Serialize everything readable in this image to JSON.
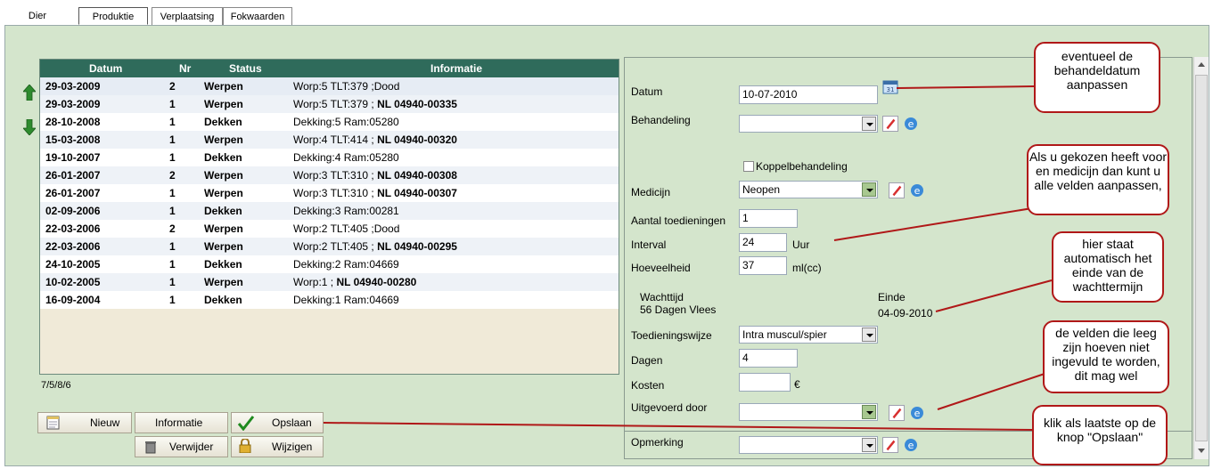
{
  "tabs": [
    "Dier",
    "Produktie",
    "Verplaatsing",
    "Fokwaarden"
  ],
  "table": {
    "headers": {
      "datum": "Datum",
      "nr": "Nr",
      "status": "Status",
      "informatie": "Informatie"
    },
    "rows": [
      {
        "datum": "29-03-2009",
        "nr": "2",
        "status": "Werpen",
        "info": "Worp:5 TLT:379 ;Dood",
        "info_bold": ""
      },
      {
        "datum": "29-03-2009",
        "nr": "1",
        "status": "Werpen",
        "info": "Worp:5 TLT:379 ; ",
        "info_bold": "NL 04940-00335"
      },
      {
        "datum": "28-10-2008",
        "nr": "1",
        "status": "Dekken",
        "info": "Dekking:5 Ram:05280",
        "info_bold": ""
      },
      {
        "datum": "15-03-2008",
        "nr": "1",
        "status": "Werpen",
        "info": "Worp:4 TLT:414 ; ",
        "info_bold": "NL 04940-00320"
      },
      {
        "datum": "19-10-2007",
        "nr": "1",
        "status": "Dekken",
        "info": "Dekking:4 Ram:05280",
        "info_bold": ""
      },
      {
        "datum": "26-01-2007",
        "nr": "2",
        "status": "Werpen",
        "info": "Worp:3 TLT:310 ; ",
        "info_bold": "NL 04940-00308"
      },
      {
        "datum": "26-01-2007",
        "nr": "1",
        "status": "Werpen",
        "info": "Worp:3 TLT:310 ; ",
        "info_bold": "NL 04940-00307"
      },
      {
        "datum": "02-09-2006",
        "nr": "1",
        "status": "Dekken",
        "info": "Dekking:3 Ram:00281",
        "info_bold": ""
      },
      {
        "datum": "22-03-2006",
        "nr": "2",
        "status": "Werpen",
        "info": "Worp:2 TLT:405 ;Dood",
        "info_bold": ""
      },
      {
        "datum": "22-03-2006",
        "nr": "1",
        "status": "Werpen",
        "info": "Worp:2 TLT:405 ; ",
        "info_bold": "NL 04940-00295"
      },
      {
        "datum": "24-10-2005",
        "nr": "1",
        "status": "Dekken",
        "info": "Dekking:2 Ram:04669",
        "info_bold": ""
      },
      {
        "datum": "10-02-2005",
        "nr": "1",
        "status": "Werpen",
        "info": "Worp:1 ; ",
        "info_bold": "NL 04940-00280"
      },
      {
        "datum": "16-09-2004",
        "nr": "1",
        "status": "Dekken",
        "info": "Dekking:1 Ram:04669",
        "info_bold": ""
      }
    ]
  },
  "counts": "7/5/8/6",
  "buttons": {
    "nieuw": "Nieuw",
    "informatie": "Informatie",
    "opslaan": "Opslaan",
    "verwijder": "Verwijder",
    "wijzigen": "Wijzigen"
  },
  "form": {
    "datum_label": "Datum",
    "datum_value": "10-07-2010",
    "behandeling_label": "Behandeling",
    "behandeling_value": "",
    "koppel_label": "Koppelbehandeling",
    "medicijn_label": "Medicijn",
    "medicijn_value": "Neopen",
    "aantal_label": "Aantal toedieningen",
    "aantal_value": "1",
    "interval_label": "Interval",
    "interval_value": "24",
    "interval_unit": "Uur",
    "hoeveelheid_label": "Hoeveelheid",
    "hoeveelheid_value": "37",
    "hoeveelheid_unit": "ml(cc)",
    "wachttijd_label": "Wachttijd",
    "wachttijd_value": "56 Dagen Vlees",
    "einde_label": "Einde",
    "einde_value": "04-09-2010",
    "toediening_label": "Toedieningswijze",
    "toediening_value": "Intra muscul/spier",
    "dagen_label": "Dagen",
    "dagen_value": "4",
    "kosten_label": "Kosten",
    "kosten_value": "",
    "kosten_unit": "€",
    "uitgevoerd_label": "Uitgevoerd door",
    "uitgevoerd_value": "",
    "opmerking_label": "Opmerking",
    "opmerking_value": ""
  },
  "callouts": {
    "c1": "eventueel de behandeldatum aanpassen",
    "c2": "Als u gekozen heeft voor en medicijn dan kunt u alle velden aanpassen,",
    "c3": "hier staat automatisch het einde van de wachttermijn",
    "c4": "de velden die leeg zijn hoeven niet ingevuld te worden, dit mag wel",
    "c5": "klik als laatste op de knop \"Opslaan\""
  },
  "colors": {
    "header": "#2f6b5b",
    "panel": "#d4e5cc",
    "callout_border": "#b01818"
  }
}
